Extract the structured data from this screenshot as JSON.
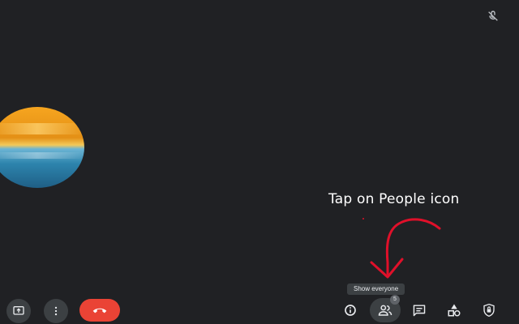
{
  "annotation": {
    "instruction": "Tap on People icon"
  },
  "tooltip": {
    "text": "Show everyone"
  },
  "participants": {
    "count": "5"
  },
  "icons": {
    "muted": "mic-off-icon",
    "present": "present-screen-icon",
    "more": "more-vertical-icon",
    "hangup": "call-end-icon",
    "info": "info-icon",
    "people": "people-icon",
    "chat": "chat-icon",
    "activities": "activities-icon",
    "host_controls": "lock-shield-icon"
  },
  "colors": {
    "background": "#202124",
    "hangup": "#ea4335",
    "button": "#3c4043",
    "arrow": "#e0102a"
  }
}
